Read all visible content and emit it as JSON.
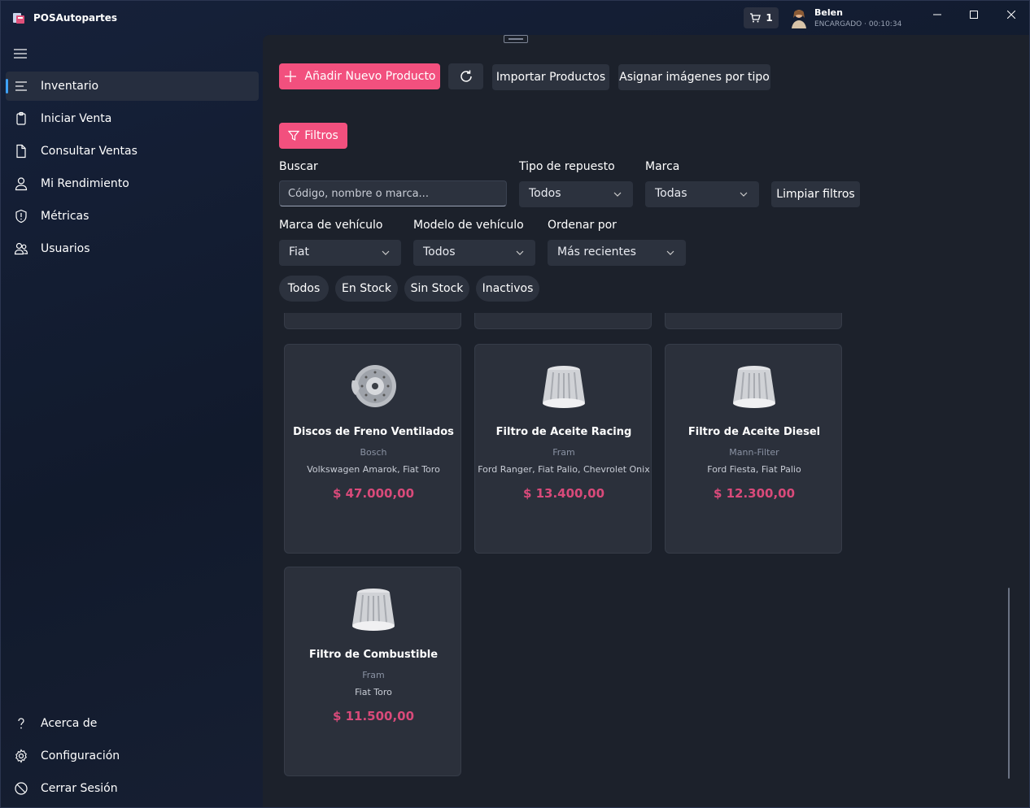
{
  "app": {
    "title": "POSAutopartes"
  },
  "titlebar": {
    "cart_count": "1",
    "user_name": "Belen",
    "user_role": "ENCARGADO",
    "session_time": "00:10:34"
  },
  "sidebar": {
    "items": [
      {
        "label": "Inventario",
        "icon": "list-icon"
      },
      {
        "label": "Iniciar Venta",
        "icon": "clipboard-icon"
      },
      {
        "label": "Consultar Ventas",
        "icon": "document-icon"
      },
      {
        "label": "Mi Rendimiento",
        "icon": "person-icon"
      },
      {
        "label": "Métricas",
        "icon": "shield-icon"
      },
      {
        "label": "Usuarios",
        "icon": "people-icon"
      }
    ],
    "footer_items": [
      {
        "label": "Acerca de",
        "icon": "question-icon"
      },
      {
        "label": "Configuración",
        "icon": "gear-icon"
      },
      {
        "label": "Cerrar Sesión",
        "icon": "logout-icon"
      }
    ]
  },
  "toolbar": {
    "add_label": "Añadir Nuevo Producto",
    "import_label": "Importar Productos",
    "assign_images_label": "Asignar imágenes por tipo"
  },
  "filters": {
    "toggle_label": "Filtros",
    "search_label": "Buscar",
    "search_placeholder": "Código, nombre o marca...",
    "part_type_label": "Tipo de repuesto",
    "part_type_value": "Todos",
    "brand_label": "Marca",
    "brand_value": "Todas",
    "clear_label": "Limpiar filtros",
    "vehicle_brand_label": "Marca de vehículo",
    "vehicle_brand_value": "Fiat",
    "vehicle_model_label": "Modelo de vehículo",
    "vehicle_model_value": "Todos",
    "sort_label": "Ordenar por",
    "sort_value": "Más recientes",
    "stock_tabs": [
      "Todos",
      "En Stock",
      "Sin Stock",
      "Inactivos"
    ]
  },
  "products": [
    {
      "name": "Discos de Freno Ventilados",
      "brand": "Bosch",
      "compat": "Volkswagen Amarok, Fiat Toro",
      "price": "$ 47.000,00",
      "icon": "brake-disc-icon"
    },
    {
      "name": "Filtro de Aceite Racing",
      "brand": "Fram",
      "compat": "Ford Ranger, Fiat Palio, Chevrolet Onix",
      "price": "$ 13.400,00",
      "icon": "filter-icon"
    },
    {
      "name": "Filtro de Aceite Diesel",
      "brand": "Mann-Filter",
      "compat": "Ford Fiesta, Fiat Palio",
      "price": "$ 12.300,00",
      "icon": "filter-icon"
    },
    {
      "name": "Filtro de Combustible",
      "brand": "Fram",
      "compat": "Fiat Toro",
      "price": "$ 11.500,00",
      "icon": "filter-icon"
    }
  ],
  "colors": {
    "accent": "#f2507e",
    "price": "#d94a7a",
    "nav_indicator": "#3fa2f7"
  }
}
